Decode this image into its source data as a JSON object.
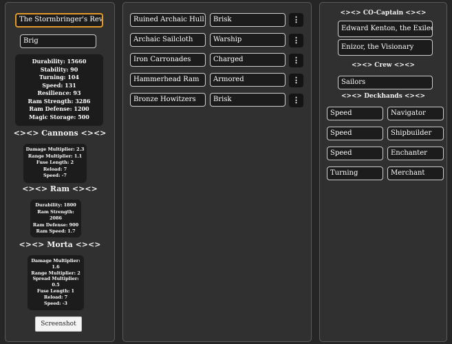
{
  "ship": {
    "name": "The Stormbringer's Revenge",
    "class": "Brig",
    "stats": [
      "Durability: 15660",
      "Stability: 90",
      "Turning: 104",
      "Speed: 131",
      "Resilience: 93",
      "Ram Strength: 3286",
      "Ram Defense: 1200",
      "Magic Storage: 500"
    ]
  },
  "cannons": {
    "heading": "<><> Cannons <><>",
    "stats": [
      "Damage Multiplier: 2.3",
      "Range Multiplier: 1.1",
      "Fuse Length: 2",
      "Reload: 7",
      "Speed: -7"
    ]
  },
  "ram": {
    "heading": "<><> Ram <><>",
    "stats": [
      "Durability: 1800",
      "Ram Strength:",
      "2086",
      "Ram Defense: 900",
      "Ram Speed: 1.7"
    ]
  },
  "morta": {
    "heading": "<><> Morta <><>",
    "stats": [
      "Damage Multiplier:",
      "1.6",
      "Range Multiplier: 2",
      "Spread Multiplier:",
      "0.5",
      "Fuse Length: 1",
      "Reload: 7",
      "Speed: -3"
    ]
  },
  "screenshot_label": "Screenshot",
  "components": [
    {
      "part": "Ruined Archaic Hull",
      "modifier": "Brisk",
      "menu": "⋮"
    },
    {
      "part": "Archaic Sailcloth",
      "modifier": "Warship",
      "menu": "⋮"
    },
    {
      "part": "Iron Carronades",
      "modifier": "Charged",
      "menu": "⋮"
    },
    {
      "part": "Hammerhead Ram",
      "modifier": "Armored",
      "menu": "⋮"
    },
    {
      "part": "Bronze Howitzers",
      "modifier": "Brisk",
      "menu": "⋮"
    }
  ],
  "crew_panel": {
    "co_captain_heading": "<><> CO-Captain <><>",
    "co_captains": [
      "Edward Kenton, the Exiled Captain",
      "Enizor, the Visionary"
    ],
    "crew_heading": "<><> Crew <><>",
    "crew": "Sailors",
    "deckhands_heading": "<><> Deckhands <><>",
    "deckhands": [
      {
        "trait": "Speed",
        "role": "Navigator"
      },
      {
        "trait": "Speed",
        "role": "Shipbuilder"
      },
      {
        "trait": "Speed",
        "role": "Enchanter"
      },
      {
        "trait": "Turning",
        "role": "Merchant"
      }
    ]
  }
}
